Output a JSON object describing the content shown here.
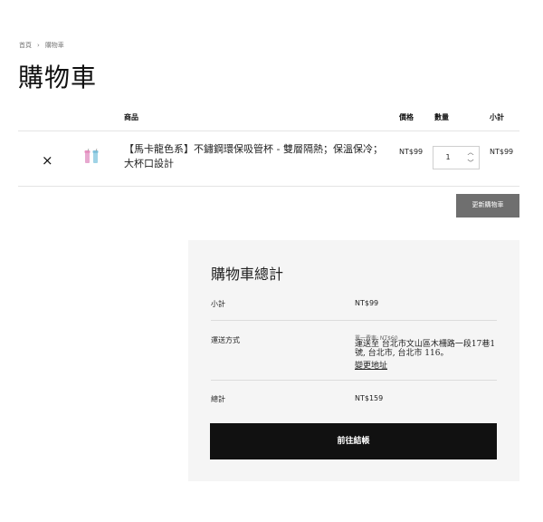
{
  "breadcrumb": {
    "home": "首頁",
    "separator": "›",
    "current": "購物車"
  },
  "page_title": "購物車",
  "table": {
    "headers": {
      "product": "商品",
      "price": "價格",
      "quantity": "數量",
      "subtotal": "小計"
    },
    "items": [
      {
        "remove_icon": "×",
        "name": "【馬卡龍色系】不鏽鋼環保吸管杯 - 雙層隔熱；保溫保冷；大杯口設計",
        "price": "NT$99",
        "quantity": "1",
        "subtotal": "NT$99"
      }
    ]
  },
  "update_button": "更新購物車",
  "totals": {
    "title": "購物車總計",
    "subtotal_label": "小計",
    "subtotal_value": "NT$99",
    "shipping_label": "運送方式",
    "shipping_option": "單一費率: NT$60",
    "shipping_destination": "運送至 台北市文山區木柵路一段17巷1號, 台北市, 台北市 116。",
    "change_address": "變更地址",
    "total_label": "總計",
    "total_value": "NT$159",
    "checkout_button": "前往結帳"
  },
  "colors": {
    "update_button_bg": "#6f6f6f",
    "checkout_bg": "#111111",
    "totals_bg": "#f5f5f5"
  }
}
